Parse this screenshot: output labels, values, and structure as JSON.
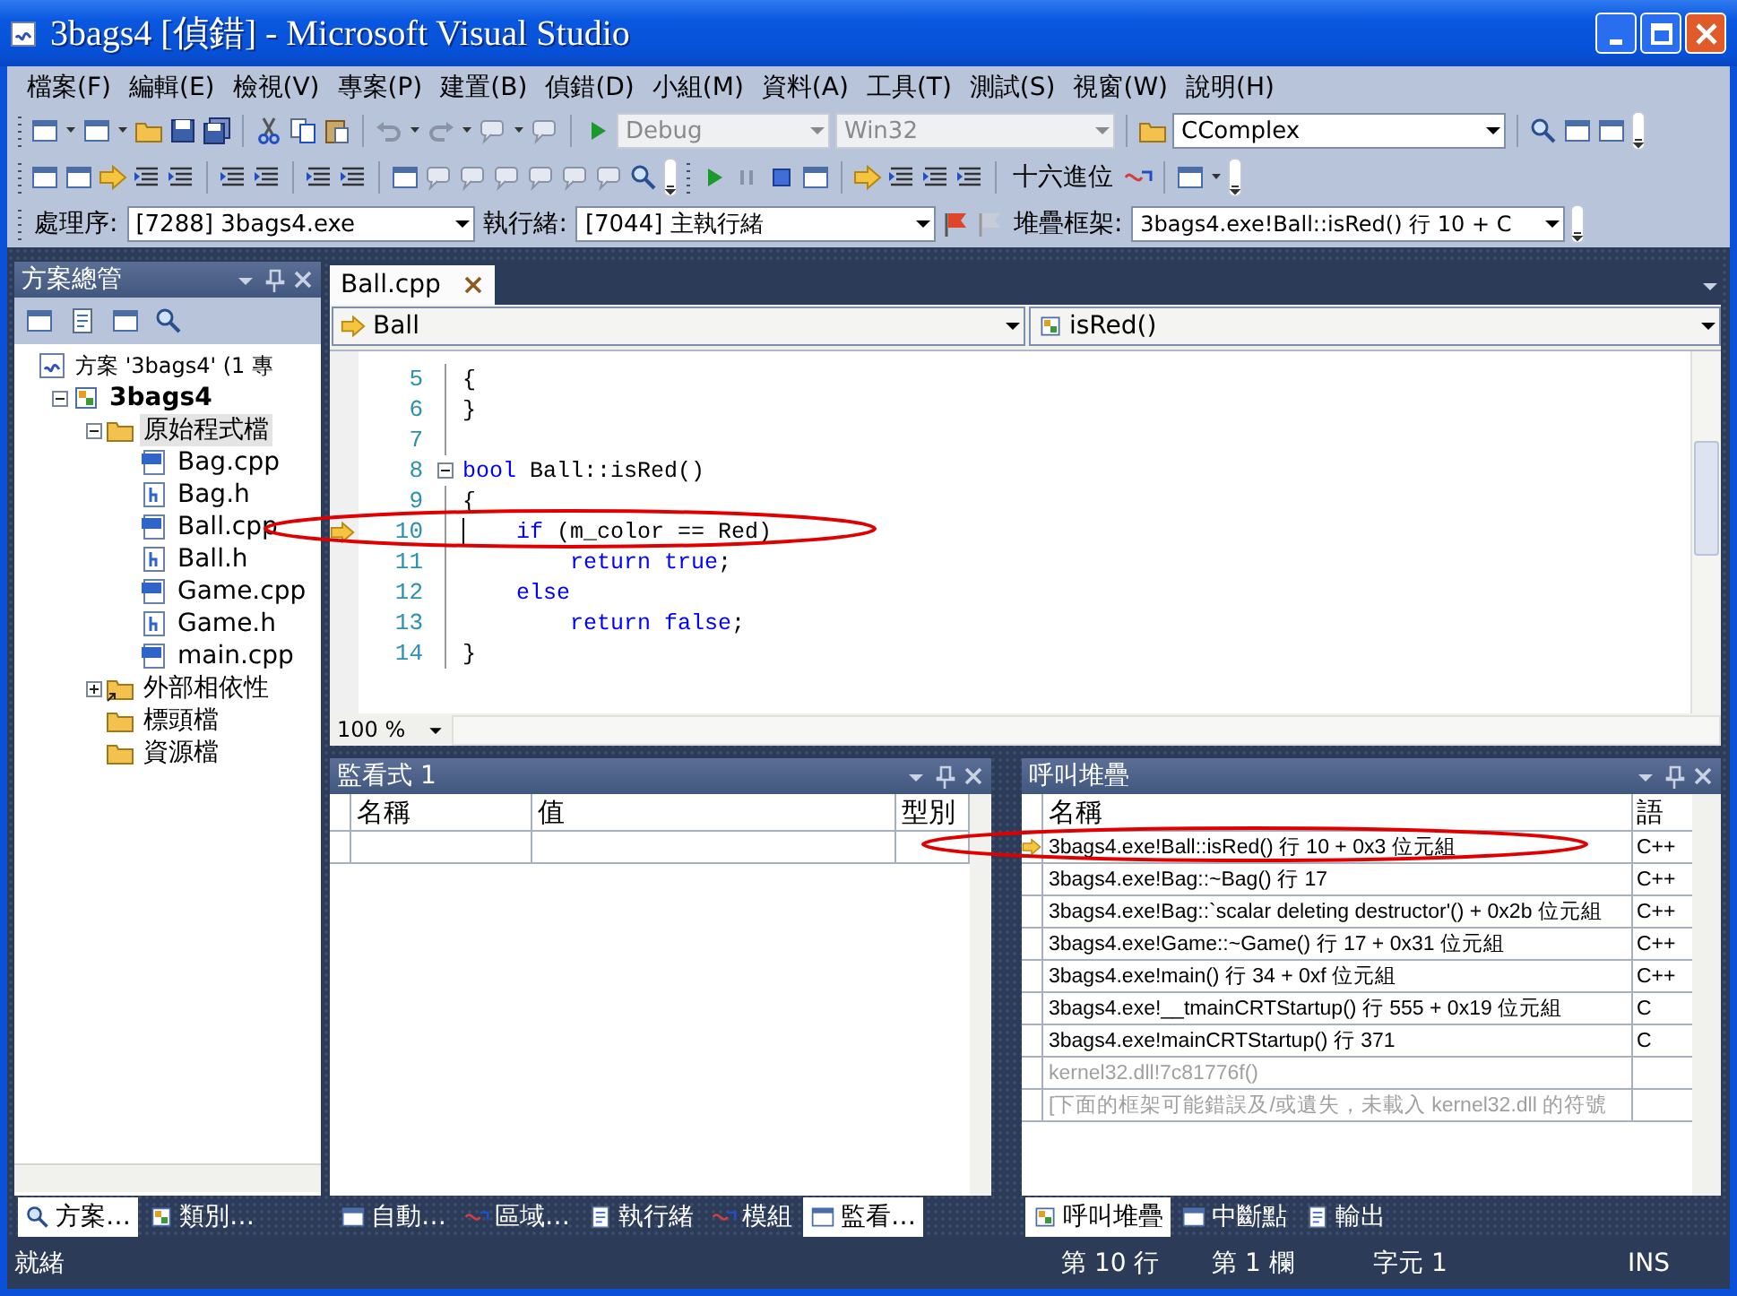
{
  "window": {
    "title": "3bags4 [偵錯] - Microsoft Visual Studio"
  },
  "menu": [
    "檔案(F)",
    "編輯(E)",
    "檢視(V)",
    "專案(P)",
    "建置(B)",
    "偵錯(D)",
    "小組(M)",
    "資料(A)",
    "工具(T)",
    "測試(S)",
    "視窗(W)",
    "說明(H)"
  ],
  "standard_toolbar": {
    "configuration": {
      "value": "Debug",
      "disabled": true
    },
    "platform": {
      "value": "Win32",
      "disabled": true
    },
    "find": {
      "value": "CComplex",
      "disabled": false
    }
  },
  "debug_toolbar": {
    "hex_button": "十六進位"
  },
  "debug_location": {
    "process_label": "處理序:",
    "process": "[7288] 3bags4.exe",
    "thread_label": "執行緒:",
    "thread": "[7044] 主執行緒",
    "frame_label": "堆疊框架:",
    "frame": "3bags4.exe!Ball::isRed()  行 10 + C"
  },
  "solution_explorer": {
    "title": "方案總管",
    "tree": [
      {
        "label": "方案 '3bags4' (1 專",
        "kind": "solution",
        "selected": false,
        "children": [
          {
            "label": "3bags4",
            "kind": "project",
            "selected": false,
            "expanded": true,
            "children": [
              {
                "label": "原始程式檔",
                "kind": "folder",
                "selected": true,
                "expanded": true,
                "children": [
                  {
                    "label": "Bag.cpp",
                    "kind": "cpp",
                    "selected": false
                  },
                  {
                    "label": "Bag.h",
                    "kind": "header",
                    "selected": false
                  },
                  {
                    "label": "Ball.cpp",
                    "kind": "cpp",
                    "selected": false
                  },
                  {
                    "label": "Ball.h",
                    "kind": "header",
                    "selected": false
                  },
                  {
                    "label": "Game.cpp",
                    "kind": "cpp",
                    "selected": false
                  },
                  {
                    "label": "Game.h",
                    "kind": "header",
                    "selected": false
                  },
                  {
                    "label": "main.cpp",
                    "kind": "cpp",
                    "selected": false
                  }
                ]
              },
              {
                "label": "外部相依性",
                "kind": "dependencies",
                "selected": false,
                "expanded": false
              },
              {
                "label": "標頭檔",
                "kind": "folder",
                "selected": false
              },
              {
                "label": "資源檔",
                "kind": "folder",
                "selected": false
              }
            ]
          }
        ]
      }
    ]
  },
  "editor": {
    "tabs": [
      {
        "label": "Ball.cpp",
        "selected": true
      }
    ],
    "class_dropdown": "Ball",
    "member_dropdown": "isRed()",
    "zoom": "100 %",
    "lines": [
      {
        "number": "5",
        "segments": [
          {
            "kind": "plain",
            "text": "{"
          }
        ]
      },
      {
        "number": "6",
        "segments": [
          {
            "kind": "plain",
            "text": "}"
          }
        ]
      },
      {
        "number": "7"
      },
      {
        "number": "8",
        "fold": true,
        "segments": [
          {
            "kind": "keyword",
            "text": "bool"
          },
          {
            "kind": "plain",
            "text": " Ball::isRed()"
          }
        ]
      },
      {
        "number": "9",
        "segments": [
          {
            "kind": "plain",
            "text": "{"
          }
        ]
      },
      {
        "number": "10",
        "current": true,
        "caret": true,
        "segments": [
          {
            "kind": "keyword",
            "text": "    if"
          },
          {
            "kind": "plain",
            "text": " (m_color == Red)"
          }
        ]
      },
      {
        "number": "11",
        "segments": [
          {
            "kind": "keyword",
            "text": "        return true"
          },
          {
            "kind": "plain",
            "text": ";"
          }
        ]
      },
      {
        "number": "12",
        "segments": [
          {
            "kind": "keyword",
            "text": "    else"
          }
        ]
      },
      {
        "number": "13",
        "segments": [
          {
            "kind": "keyword",
            "text": "        return false"
          },
          {
            "kind": "plain",
            "text": ";"
          }
        ]
      },
      {
        "number": "14",
        "segments": [
          {
            "kind": "plain",
            "text": "}"
          }
        ]
      }
    ]
  },
  "watch": {
    "title": "監看式 1",
    "columns": [
      "名稱",
      "值",
      "型別"
    ]
  },
  "call_stack": {
    "title": "呼叫堆疊",
    "columns": [
      "名稱",
      "語"
    ],
    "rows": [
      {
        "name": "3bags4.exe!Ball::isRed()  行 10 + 0x3 位元組",
        "language": "C++",
        "current": true,
        "disabled": false
      },
      {
        "name": "3bags4.exe!Bag::~Bag()  行 17",
        "language": "C++",
        "current": false,
        "disabled": false
      },
      {
        "name": "3bags4.exe!Bag::`scalar deleting destructor'()  + 0x2b 位元組",
        "language": "C++",
        "current": false,
        "disabled": false
      },
      {
        "name": "3bags4.exe!Game::~Game()  行 17 + 0x31 位元組",
        "language": "C++",
        "current": false,
        "disabled": false
      },
      {
        "name": "3bags4.exe!main()  行 34 + 0xf 位元組",
        "language": "C++",
        "current": false,
        "disabled": false
      },
      {
        "name": "3bags4.exe!__tmainCRTStartup()  行 555 + 0x19 位元組",
        "language": "C",
        "current": false,
        "disabled": false
      },
      {
        "name": "3bags4.exe!mainCRTStartup()  行 371",
        "language": "C",
        "current": false,
        "disabled": false
      },
      {
        "name": "kernel32.dll!7c81776f()",
        "current": false,
        "disabled": true
      },
      {
        "name": "[下面的框架可能錯誤及/或遺失，未載入 kernel32.dll 的符號",
        "current": false,
        "disabled": true
      }
    ]
  },
  "left_tabs": [
    {
      "label": "方案…",
      "selected": true
    },
    {
      "label": "類別…",
      "selected": false
    }
  ],
  "middle_tabs": [
    {
      "label": "自動…",
      "selected": false
    },
    {
      "label": "區域…",
      "selected": false
    },
    {
      "label": "執行緒",
      "selected": false
    },
    {
      "label": "模組",
      "selected": false
    },
    {
      "label": "監看…",
      "selected": true
    }
  ],
  "right_tabs": [
    {
      "label": "呼叫堆疊",
      "selected": true
    },
    {
      "label": "中斷點",
      "selected": false
    },
    {
      "label": "輸出",
      "selected": false
    }
  ],
  "status_bar": {
    "message": "就緒",
    "line": "第 10 行",
    "column": "第 1 欄",
    "char": "字元 1",
    "mode": "INS"
  }
}
